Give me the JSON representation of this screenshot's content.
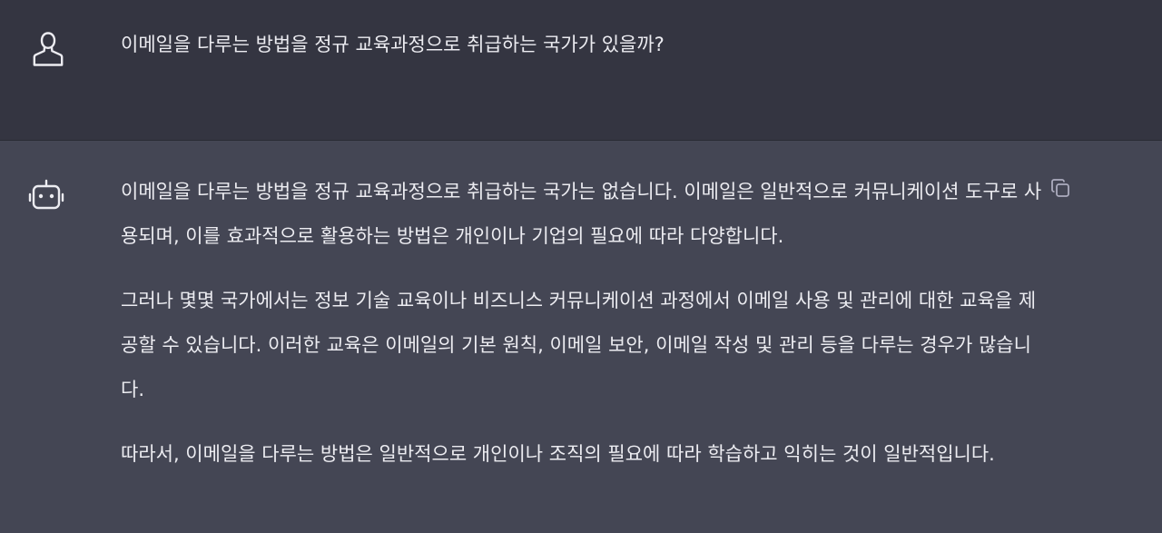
{
  "colors": {
    "user_bg": "#343541",
    "assistant_bg": "#444654",
    "text": "#ececf1",
    "icon": "#ececf1",
    "copy_icon": "#acacbe"
  },
  "icons": {
    "user_avatar": "user-icon",
    "assistant_avatar": "robot-icon",
    "copy": "copy-icon"
  },
  "conversation": {
    "user_message": "이메일을 다루는 방법을 정규 교육과정으로 취급하는 국가가 있을까?",
    "assistant_paragraphs": [
      "이메일을 다루는 방법을 정규 교육과정으로 취급하는 국가는 없습니다. 이메일은 일반적으로 커뮤니케이션 도구로 사용되며, 이를 효과적으로 활용하는 방법은 개인이나 기업의 필요에 따라 다양합니다.",
      "그러나 몇몇 국가에서는 정보 기술 교육이나 비즈니스 커뮤니케이션 과정에서 이메일 사용 및 관리에 대한 교육을 제공할 수 있습니다. 이러한 교육은 이메일의 기본 원칙, 이메일 보안, 이메일 작성 및 관리 등을 다루는 경우가 많습니다.",
      "따라서, 이메일을 다루는 방법은 일반적으로 개인이나 조직의 필요에 따라 학습하고 익히는 것이 일반적입니다."
    ]
  }
}
